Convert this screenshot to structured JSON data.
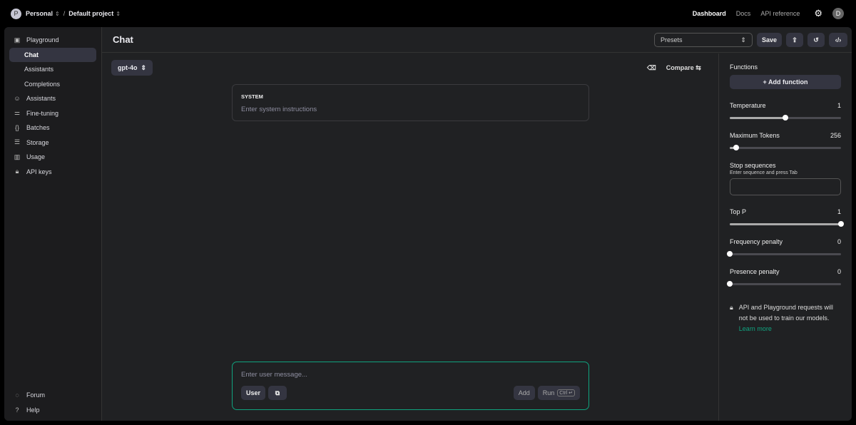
{
  "topbar": {
    "avatar": "P",
    "org": "Personal",
    "separator": "/",
    "project": "Default project",
    "links": [
      "Dashboard",
      "Docs",
      "API reference"
    ],
    "user_avatar": "D"
  },
  "sidebar": {
    "items": [
      {
        "label": "Playground",
        "icon": "terminal-icon"
      },
      {
        "label": "Chat",
        "sub": true,
        "selected": true
      },
      {
        "label": "Assistants",
        "sub": true
      },
      {
        "label": "Completions",
        "sub": true
      },
      {
        "label": "Assistants",
        "icon": "robot-icon"
      },
      {
        "label": "Fine-tuning",
        "icon": "sliders-icon"
      },
      {
        "label": "Batches",
        "icon": "braces-icon"
      },
      {
        "label": "Storage",
        "icon": "database-icon"
      },
      {
        "label": "Usage",
        "icon": "bar-chart-icon"
      },
      {
        "label": "API keys",
        "icon": "lock-icon"
      }
    ],
    "bottom": [
      {
        "label": "Forum"
      },
      {
        "label": "Help"
      }
    ]
  },
  "header": {
    "title": "Chat",
    "presets": "Presets",
    "save": "Save"
  },
  "chat": {
    "model": "gpt-4o",
    "compare": "Compare",
    "system_label": "SYSTEM",
    "system_placeholder": "Enter system instructions",
    "user_placeholder": "Enter user message...",
    "role": "User",
    "add": "Add",
    "run": "Run",
    "run_shortcut": "Ctrl ↵"
  },
  "settings": {
    "functions": "Functions",
    "add_function": "+ Add function",
    "temperature": {
      "label": "Temperature",
      "value": "1",
      "fraction": 0.5
    },
    "max_tokens": {
      "label": "Maximum Tokens",
      "value": "256",
      "fraction": 0.06
    },
    "stop": {
      "label": "Stop sequences",
      "hint": "Enter sequence and press Tab"
    },
    "top_p": {
      "label": "Top P",
      "value": "1",
      "fraction": 1
    },
    "frequency": {
      "label": "Frequency penalty",
      "value": "0",
      "fraction": 0
    },
    "presence": {
      "label": "Presence penalty",
      "value": "0",
      "fraction": 0
    },
    "note": "API and Playground requests will not be used to train our models.",
    "learn_more": "Learn more"
  },
  "colors": {
    "accent": "#10a37f"
  }
}
